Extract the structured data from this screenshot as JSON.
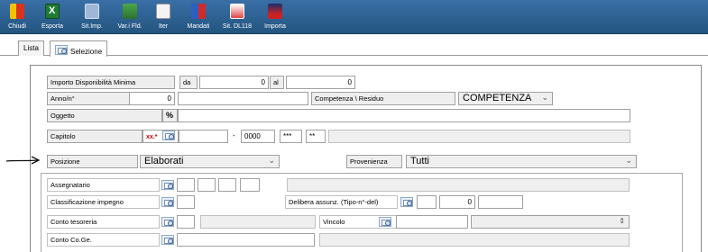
{
  "toolbar": {
    "buttons": [
      {
        "label": "Chiudi"
      },
      {
        "label": "Esporta"
      },
      {
        "label": "Sit.Imp."
      },
      {
        "label": "Var.i Fld."
      },
      {
        "label": "Iter"
      },
      {
        "label": "Mandati"
      },
      {
        "label": "Sit. DL118"
      },
      {
        "label": "Importa"
      }
    ]
  },
  "tabs": [
    {
      "label": "Lista"
    },
    {
      "label": "Selezione"
    }
  ],
  "form": {
    "importo_label": "Importo Disponibilità Minima",
    "da_label": "da",
    "da_value": "0",
    "al_label": "al",
    "al_value": "0",
    "anno_label": "Anno/n°",
    "anno_value": "0",
    "competenza_label": "Competenza \\ Residuo",
    "competenza_value": "COMPETENZA",
    "oggetto_label": "Oggetto",
    "oggetto_prefix": "%",
    "capitolo_label": "Capitolo",
    "capitolo_mask": "xx.*",
    "capitolo_dash": "-",
    "capitolo_num": "0000",
    "capitolo_stars1": "***",
    "capitolo_stars2": "**",
    "posizione_label": "Posizione",
    "posizione_value": "Elaborati",
    "provenienza_label": "Provenienza",
    "provenienza_value": "Tutti",
    "assegnatario_label": "Assegnatario",
    "classificazione_label": "Classificazione impegno",
    "delibera_label": "Delibera assunz. (Tipo-n°-del)",
    "delibera_value": "0",
    "conto_tesoreria_label": "Conto tesoreria",
    "vincolo_label": "Vincolo",
    "conto_coge_label": "Conto Co.Ge."
  }
}
